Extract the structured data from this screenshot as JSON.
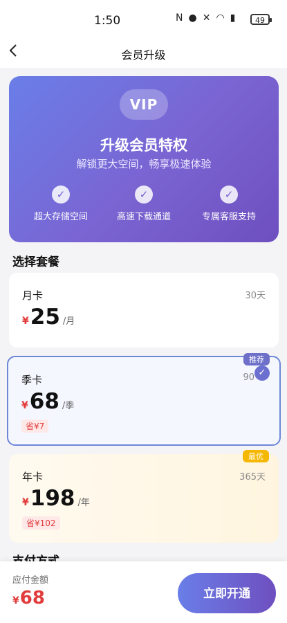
{
  "status_bar": {
    "time": "1:50",
    "battery": "49",
    "icons": [
      "nfc-icon",
      "location-icon",
      "mute-icon",
      "wifi-icon",
      "signal-5g-icon"
    ]
  },
  "header": {
    "title": "会员升级"
  },
  "hero": {
    "badge": "VIP",
    "title": "升级会员特权",
    "subtitle": "解锁更大空间，畅享极速体验",
    "features": [
      {
        "label": "超大存储空间"
      },
      {
        "label": "高速下载通道"
      },
      {
        "label": "专属客服支持"
      }
    ]
  },
  "plans": {
    "section_title": "选择套餐",
    "items": [
      {
        "name": "月卡",
        "days": "30天",
        "currency": "¥",
        "price": "25",
        "unit": "/月"
      },
      {
        "name": "季卡",
        "days": "90",
        "currency": "¥",
        "price": "68",
        "unit": "/季",
        "save": "省¥7",
        "badge": "推荐",
        "selected": true
      },
      {
        "name": "年卡",
        "days": "365天",
        "currency": "¥",
        "price": "198",
        "unit": "/年",
        "save": "省¥102",
        "badge": "最优"
      }
    ]
  },
  "payment": {
    "section_title": "支付方式"
  },
  "bottom_bar": {
    "amount_label": "应付金额",
    "currency": "¥",
    "amount": "68",
    "button_label": "立即开通"
  },
  "colors": {
    "accent": "#6e4fbf",
    "price_red": "#e23b3b",
    "best_badge": "#f5b700"
  }
}
